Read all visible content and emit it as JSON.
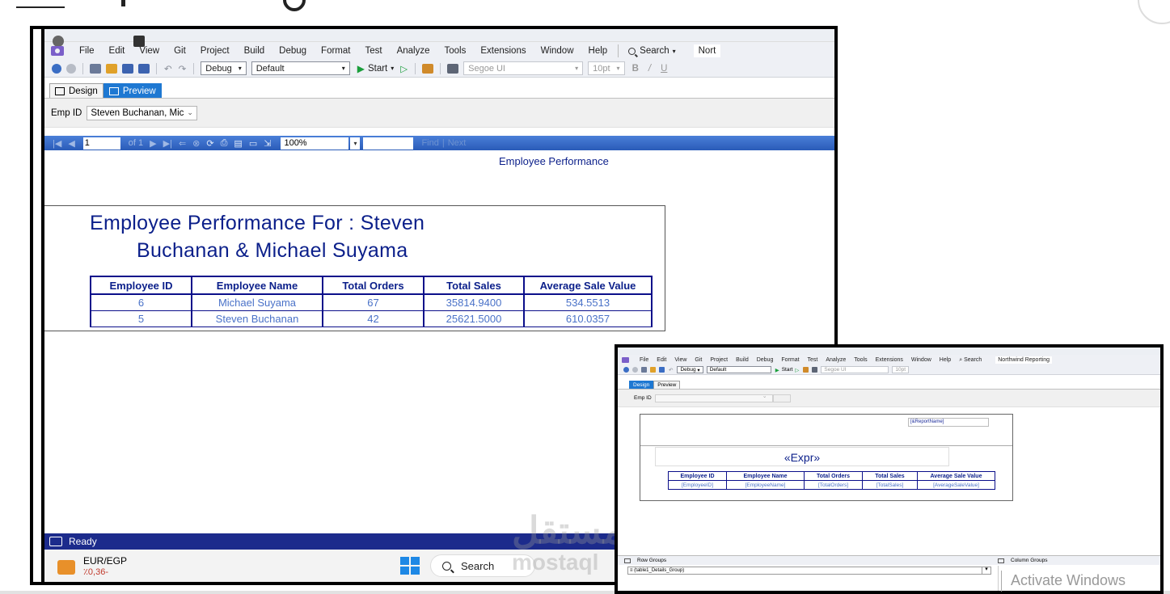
{
  "main_window": {
    "menu": [
      "File",
      "Edit",
      "View",
      "Git",
      "Project",
      "Build",
      "Debug",
      "Format",
      "Test",
      "Analyze",
      "Tools",
      "Extensions",
      "Window",
      "Help"
    ],
    "search_label": "Search",
    "project_name": "Nort",
    "toolbar": {
      "config": "Debug",
      "platform": "Default",
      "start": "Start",
      "font": "Segoe UI",
      "font_size": "10pt",
      "bold": "B",
      "italic": "/",
      "underline": "U"
    },
    "tabs": [
      {
        "label": "Design",
        "active": false
      },
      {
        "label": "Preview",
        "active": true
      }
    ],
    "param_label": "Emp ID",
    "param_value": "Steven Buchanan, Mic",
    "report_toolbar": {
      "page": "1",
      "of": "of 1",
      "zoom": "100%",
      "find": "Find",
      "next": "Next"
    },
    "report": {
      "header_title": "Employee Performance",
      "big_title_line1": "Employee Performance For : Steven",
      "big_title_line2": "Buchanan & Michael Suyama",
      "columns": [
        "Employee ID",
        "Employee Name",
        "Total Orders",
        "Total Sales",
        "Average Sale Value"
      ],
      "rows": [
        [
          "6",
          "Michael Suyama",
          "67",
          "35814.9400",
          "534.5513"
        ],
        [
          "5",
          "Steven Buchanan",
          "42",
          "25621.5000",
          "610.0357"
        ]
      ]
    },
    "status": "Ready"
  },
  "taskbar": {
    "currency_pair": "EUR/EGP",
    "currency_change": "٪0,36-",
    "search": "Search"
  },
  "watermark": {
    "arabic": "مستقل",
    "latin": "mostaql"
  },
  "design_window": {
    "menu": [
      "File",
      "Edit",
      "View",
      "Git",
      "Project",
      "Build",
      "Debug",
      "Format",
      "Test",
      "Analyze",
      "Tools",
      "Extensions",
      "Window",
      "Help"
    ],
    "search_label": "Search",
    "project_name": "Northwind Reporting",
    "toolbar": {
      "config": "Debug",
      "platform": "Default",
      "start": "Start",
      "font": "Segoe UI",
      "font_size": "10pt"
    },
    "tabs": [
      {
        "label": "Design",
        "active": true
      },
      {
        "label": "Preview",
        "active": false
      }
    ],
    "param_label": "Emp ID",
    "report_name_field": "[&ReportName]",
    "expr": "«Expr»",
    "columns": [
      "Employee ID",
      "Employee Name",
      "Total Orders",
      "Total Sales",
      "Average Sale Value"
    ],
    "fields": [
      "[EmployeeID]",
      "[EmployeeName]",
      "[TotalOrders]",
      "[TotalSales]",
      "[AverageSaleValue]"
    ],
    "row_groups": "Row Groups",
    "column_groups": "Column Groups",
    "row_group_value": "≡ (table1_Details_Group)"
  },
  "activate_windows": "Activate Windows"
}
